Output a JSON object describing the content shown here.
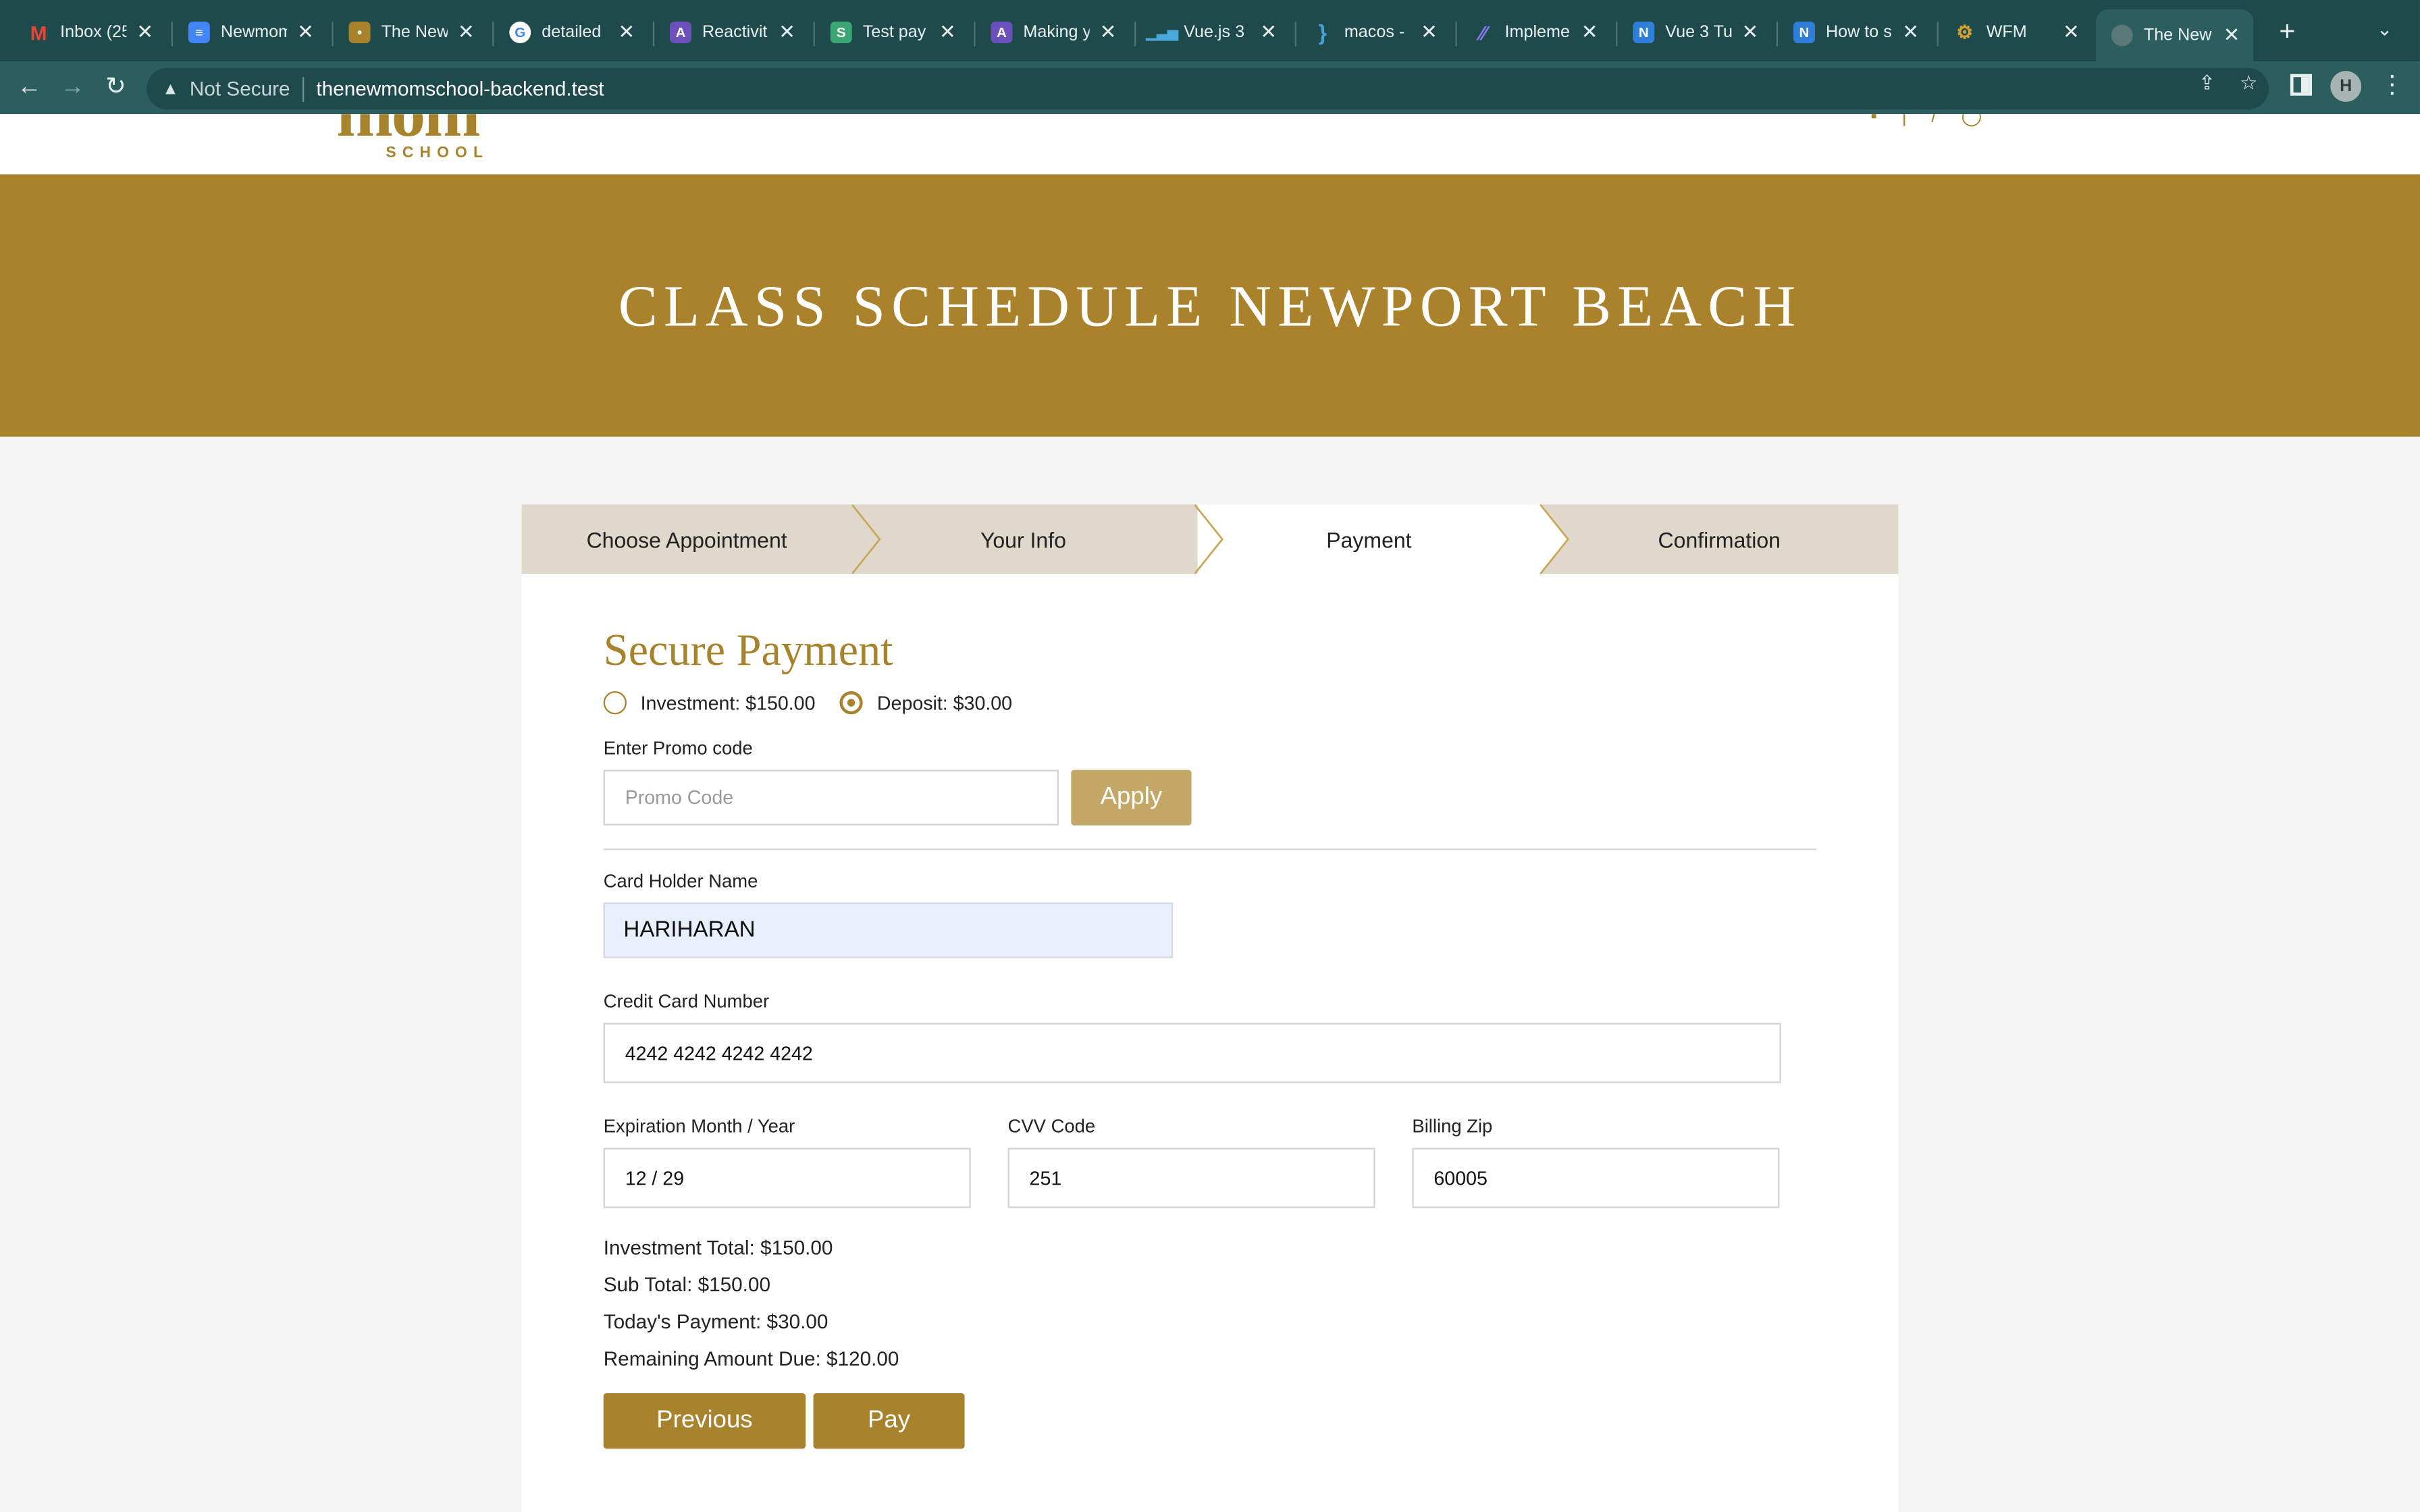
{
  "browser": {
    "tabs": [
      {
        "title": "Inbox (25",
        "icon": "gmail-icon"
      },
      {
        "title": "Newmom",
        "icon": "google-docs-icon"
      },
      {
        "title": "The New",
        "icon": "site-icon"
      },
      {
        "title": "detailed",
        "icon": "google-icon"
      },
      {
        "title": "Reactivit",
        "icon": "site-icon"
      },
      {
        "title": "Test pay",
        "icon": "site-icon"
      },
      {
        "title": "Making y",
        "icon": "site-icon"
      },
      {
        "title": "Vue.js 3",
        "icon": "chart-icon"
      },
      {
        "title": "macos -",
        "icon": "braces-icon"
      },
      {
        "title": "Impleme",
        "icon": "site-icon"
      },
      {
        "title": "Vue 3 Tu",
        "icon": "site-icon"
      },
      {
        "title": "How to s",
        "icon": "site-icon"
      },
      {
        "title": "WFM",
        "icon": "site-icon"
      },
      {
        "title": "The New",
        "icon": "globe-icon"
      }
    ],
    "security_label": "Not Secure",
    "url": "thenewmomschool-backend.test",
    "profile_initial": "H"
  },
  "site": {
    "logo_word": "mom",
    "logo_sub": "SCHOOL",
    "banner_title": "CLASS SCHEDULE NEWPORT BEACH"
  },
  "steps": [
    "Choose Appointment",
    "Your Info",
    "Payment",
    "Confirmation"
  ],
  "active_step": 2,
  "payment": {
    "title": "Secure Payment",
    "options": [
      {
        "label": "Investment: $150.00",
        "selected": false
      },
      {
        "label": "Deposit: $30.00",
        "selected": true
      }
    ],
    "promo_label": "Enter Promo code",
    "promo_placeholder": "Promo Code",
    "apply_label": "Apply",
    "card_holder_label": "Card Holder Name",
    "card_holder_value": "HARIHARAN",
    "card_number_label": "Credit Card Number",
    "card_number_value": "4242 4242 4242 4242",
    "expiry_label": "Expiration Month / Year",
    "expiry_value": "12 / 29",
    "cvv_label": "CVV Code",
    "cvv_value": "251",
    "zip_label": "Billing Zip",
    "zip_value": "60005",
    "summary": [
      "Investment Total: $150.00",
      "Sub Total: $150.00",
      "Today's Payment: $30.00",
      "Remaining Amount Due: $120.00"
    ],
    "previous_label": "Previous",
    "pay_label": "Pay"
  },
  "colors": {
    "brand_gold": "#aa822b",
    "apply_gold": "#c4a868",
    "tab_bar": "#1e4a4c",
    "toolbar": "#2c5d5f",
    "step_bg": "#dfd8cb"
  }
}
